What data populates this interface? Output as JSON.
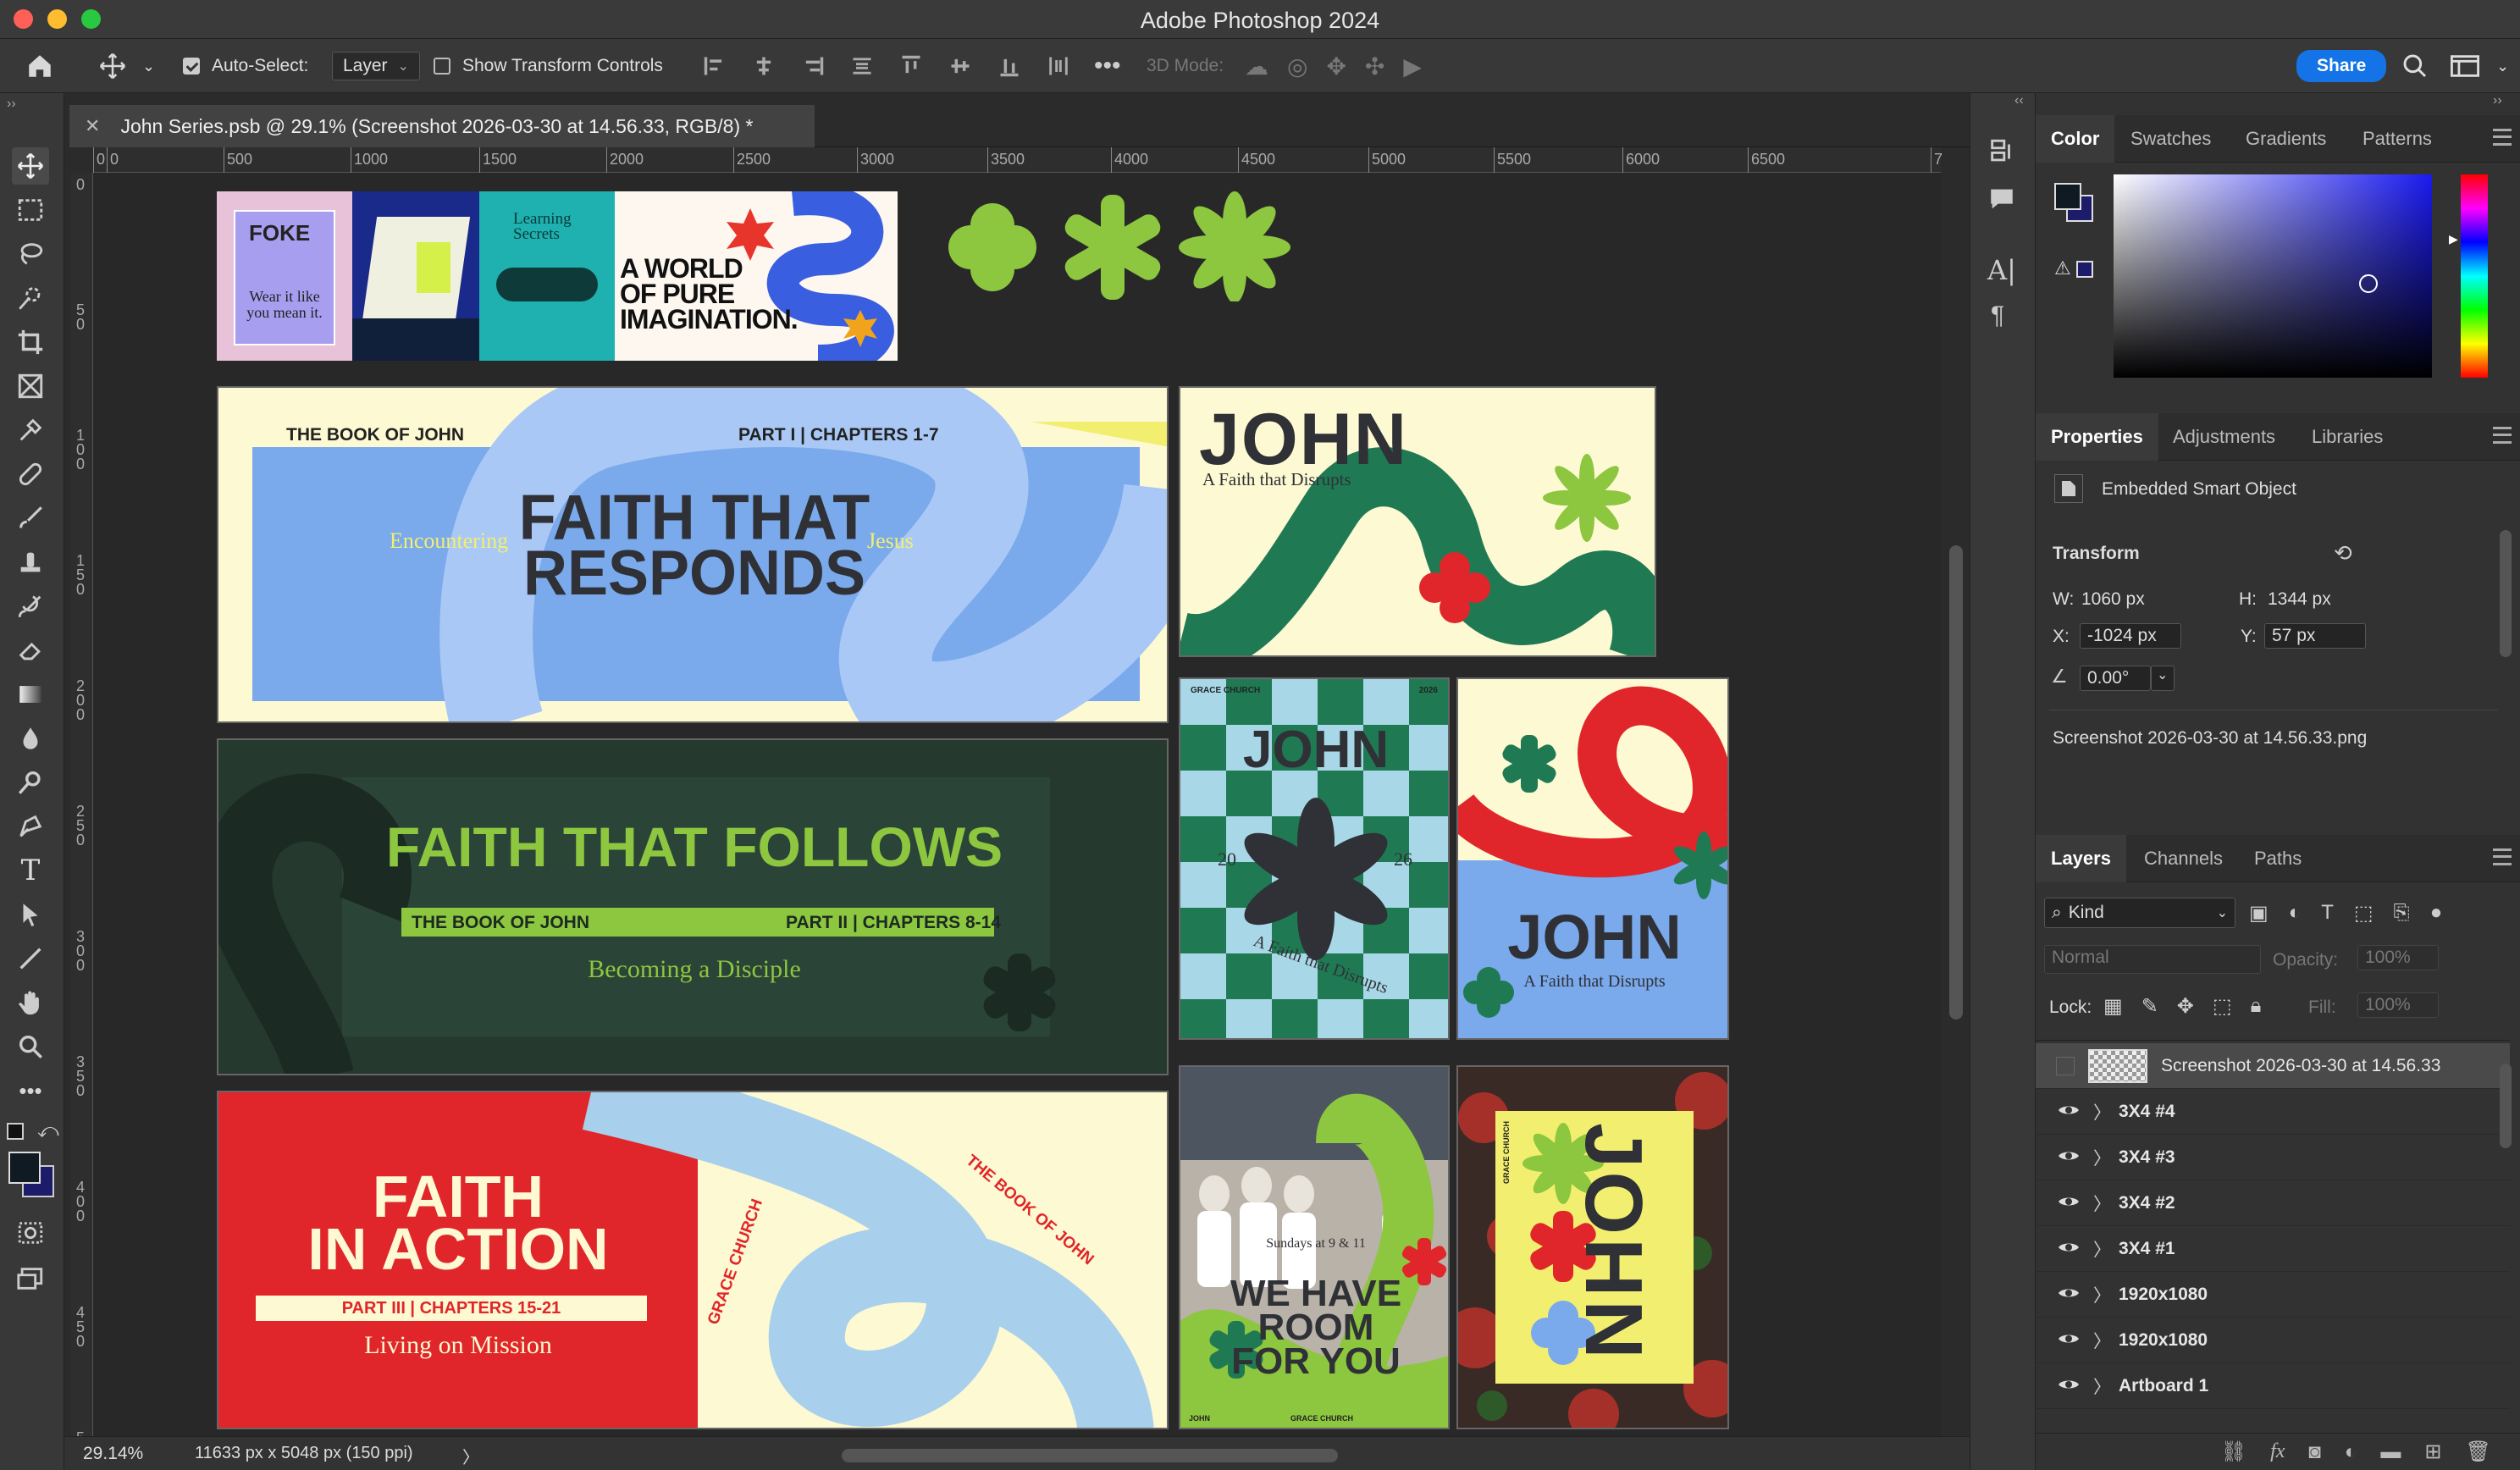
{
  "app": {
    "title": "Adobe Photoshop 2024"
  },
  "options_bar": {
    "auto_select_label": "Auto-Select:",
    "auto_select_value": "Layer",
    "show_transform_label": "Show Transform Controls",
    "mode_3d_label": "3D Mode:",
    "share_label": "Share"
  },
  "document": {
    "tab_title": "John Series.psb @ 29.1% (Screenshot 2026-03-30 at 14.56.33, RGB/8) *",
    "zoom": "29.14%",
    "doc_info": "11633 px x 5048 px (150 ppi)"
  },
  "ruler": {
    "h_ticks": [
      "0",
      "0",
      "500",
      "1000",
      "1500",
      "2000",
      "2500",
      "3000",
      "3500",
      "4000",
      "4500",
      "5000",
      "5500",
      "6000",
      "6500",
      "7"
    ],
    "v_ticks": [
      "0",
      "50",
      "100",
      "150",
      "200",
      "250",
      "300",
      "350",
      "400",
      "450",
      "5"
    ]
  },
  "artwork": {
    "banner1": {
      "header_left": "THE BOOK OF JOHN",
      "header_right": "PART I | CHAPTERS 1-7",
      "title": "FAITH THAT\nRESPONDS",
      "side_left": "Encountering",
      "side_right": "Jesus"
    },
    "banner2": {
      "title": "FAITH THAT FOLLOWS",
      "bar_left": "THE BOOK OF JOHN",
      "bar_right": "PART II | CHAPTERS 8-14",
      "subtitle": "Becoming a Disciple"
    },
    "banner3": {
      "title": "FAITH\nIN ACTION",
      "bar": "PART III | CHAPTERS 15-21",
      "subtitle": "Living on Mission",
      "curved_left": "GRACE CHURCH",
      "curved_right": "THE BOOK OF JOHN"
    },
    "poster_john": {
      "title": "JOHN",
      "subtitle": "A Faith that Disrupts"
    },
    "poster_check": {
      "top_left": "GRACE CHURCH",
      "top_right": "2026",
      "title": "JOHN",
      "num_left": "20",
      "num_right": "26",
      "curve": "A Faith that Disrupts"
    },
    "poster_red": {
      "title": "JOHN",
      "subtitle": "A Faith that Disrupts"
    },
    "poster_photo": {
      "title": "WE HAVE\nROOM\nFOR YOU",
      "small": "Sundays at 9 & 11",
      "foot_left": "JOHN",
      "foot_right": "GRACE CHURCH"
    },
    "poster_yellow": {
      "title": "JOHN",
      "side": "GRACE CHURCH"
    },
    "inspo": {
      "foke": "FOKE",
      "foke_tag": "Wear it like\nyou mean it.",
      "learn": "Learning\nSecrets",
      "world": "A WORLD\nOF PURE\nIMAGINATION."
    }
  },
  "color_panel": {
    "tabs": [
      "Color",
      "Swatches",
      "Gradients",
      "Patterns"
    ]
  },
  "properties_panel": {
    "tabs": [
      "Properties",
      "Adjustments",
      "Libraries"
    ],
    "object_type": "Embedded Smart Object",
    "transform_label": "Transform",
    "w_label": "W:",
    "w_value": "1060 px",
    "h_label": "H:",
    "h_value": "1344 px",
    "x_label": "X:",
    "x_value": "-1024 px",
    "y_label": "Y:",
    "y_value": "57 px",
    "angle_value": "0.00°",
    "filename": "Screenshot 2026-03-30 at 14.56.33.png"
  },
  "layers_panel": {
    "tabs": [
      "Layers",
      "Channels",
      "Paths"
    ],
    "kind_label": "Kind",
    "blend_mode": "Normal",
    "opacity_label": "Opacity:",
    "opacity_value": "100%",
    "lock_label": "Lock:",
    "fill_label": "Fill:",
    "fill_value": "100%",
    "selected_layer": "Screenshot 2026-03-30 at 14.56.33",
    "layers": [
      {
        "name": "3X4 #4"
      },
      {
        "name": "3X4 #3"
      },
      {
        "name": "3X4 #2"
      },
      {
        "name": "3X4 #1"
      },
      {
        "name": "1920x1080"
      },
      {
        "name": "1920x1080"
      },
      {
        "name": "Artboard 1"
      }
    ]
  },
  "colors": {
    "accent": "#1473e6",
    "green": "#8dc63f",
    "blue": "#7aa9ec",
    "cream": "#fdf9d2",
    "teal": "#1f7a54",
    "red": "#e0262a",
    "dark": "#2b3a33",
    "yellow": "#f2ef70"
  }
}
